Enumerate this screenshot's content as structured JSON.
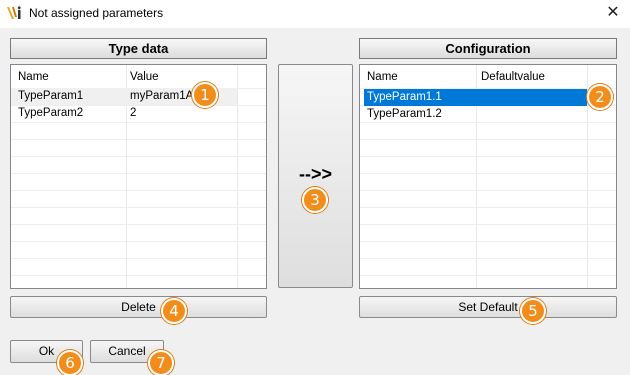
{
  "window": {
    "title": "Not assigned parameters",
    "close_glyph": "✕",
    "icon": "vi-logo-icon"
  },
  "type_data": {
    "header": "Type data",
    "columns": [
      "Name",
      "Value"
    ],
    "rows": [
      {
        "name": "TypeParam1",
        "value": "myParam1A"
      },
      {
        "name": "TypeParam2",
        "value": "2"
      }
    ]
  },
  "configuration": {
    "header": "Configuration",
    "columns": [
      "Name",
      "Defaultvalue"
    ],
    "rows": [
      {
        "name": "TypeParam1.1",
        "value": "",
        "selected": true
      },
      {
        "name": "TypeParam1.2",
        "value": ""
      }
    ]
  },
  "transfer_button": {
    "label": "-->>"
  },
  "buttons": {
    "delete": "Delete",
    "set_default": "Set Default",
    "ok": "Ok",
    "cancel": "Cancel"
  },
  "badges": [
    "1",
    "2",
    "3",
    "4",
    "5",
    "6",
    "7"
  ],
  "colors": {
    "badge": "#f28c1b",
    "selection": "#0078d7"
  }
}
